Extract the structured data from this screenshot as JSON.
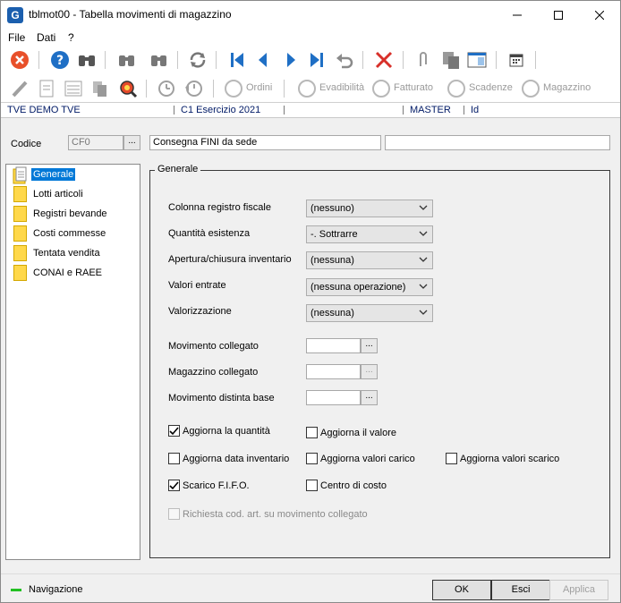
{
  "window": {
    "title": "tblmot00 - Tabella movimenti di magazzino",
    "app_icon_letter": "G"
  },
  "menu": {
    "items": [
      "File",
      "Dati",
      "?"
    ]
  },
  "toolbar2": {
    "labels": [
      "Ordini",
      "Evadibilità",
      "Fatturato",
      "Scadenze",
      "Magazzino"
    ]
  },
  "status": {
    "company": "TVE DEMO TVE",
    "exercise": "C1 Esercizio 2021",
    "user": "MASTER",
    "field": "Id"
  },
  "header": {
    "codice_label": "Codice",
    "codice_value": "CF0",
    "description": "Consegna FINI da sede",
    "extra": "",
    "dots": "..."
  },
  "tree": {
    "items": [
      "Generale",
      "Lotti articoli",
      "Registri bevande",
      "Costi commesse",
      "Tentata vendita",
      "CONAI e RAEE"
    ]
  },
  "group": {
    "title": "Generale"
  },
  "fields": {
    "colonna_label": "Colonna registro fiscale",
    "colonna_value": "(nessuno)",
    "quantita_label": "Quantità esistenza",
    "quantita_value": "-. Sottrarre",
    "apertura_label": "Apertura/chiusura inventario",
    "apertura_value": "(nessuna)",
    "valori_label": "Valori entrate",
    "valori_value": "(nessuna operazione)",
    "valorizzazione_label": "Valorizzazione",
    "valorizzazione_value": "(nessuna)",
    "mov_coll_label": "Movimento collegato",
    "mag_coll_label": "Magazzino collegato",
    "mov_dist_label": "Movimento distinta base"
  },
  "checkboxes": {
    "aggiorna_quantita": "Aggiorna la quantità",
    "aggiorna_valore": "Aggiorna il valore",
    "aggiorna_data": "Aggiorna data inventario",
    "aggiorna_carico": "Aggiorna valori carico",
    "aggiorna_scarico": "Aggiorna valori scarico",
    "scarico_fifo": "Scarico F.I.F.O.",
    "centro_costo": "Centro di costo",
    "richiesta_cod": "Richiesta cod. art. su movimento collegato"
  },
  "footer": {
    "nav_label": "Navigazione",
    "ok": "OK",
    "esci": "Esci",
    "applica": "Applica"
  },
  "colors": {
    "selection": "#0078d7",
    "folder": "#ffd84a",
    "status_text": "#001a66",
    "nav_indicator": "#22c022"
  }
}
